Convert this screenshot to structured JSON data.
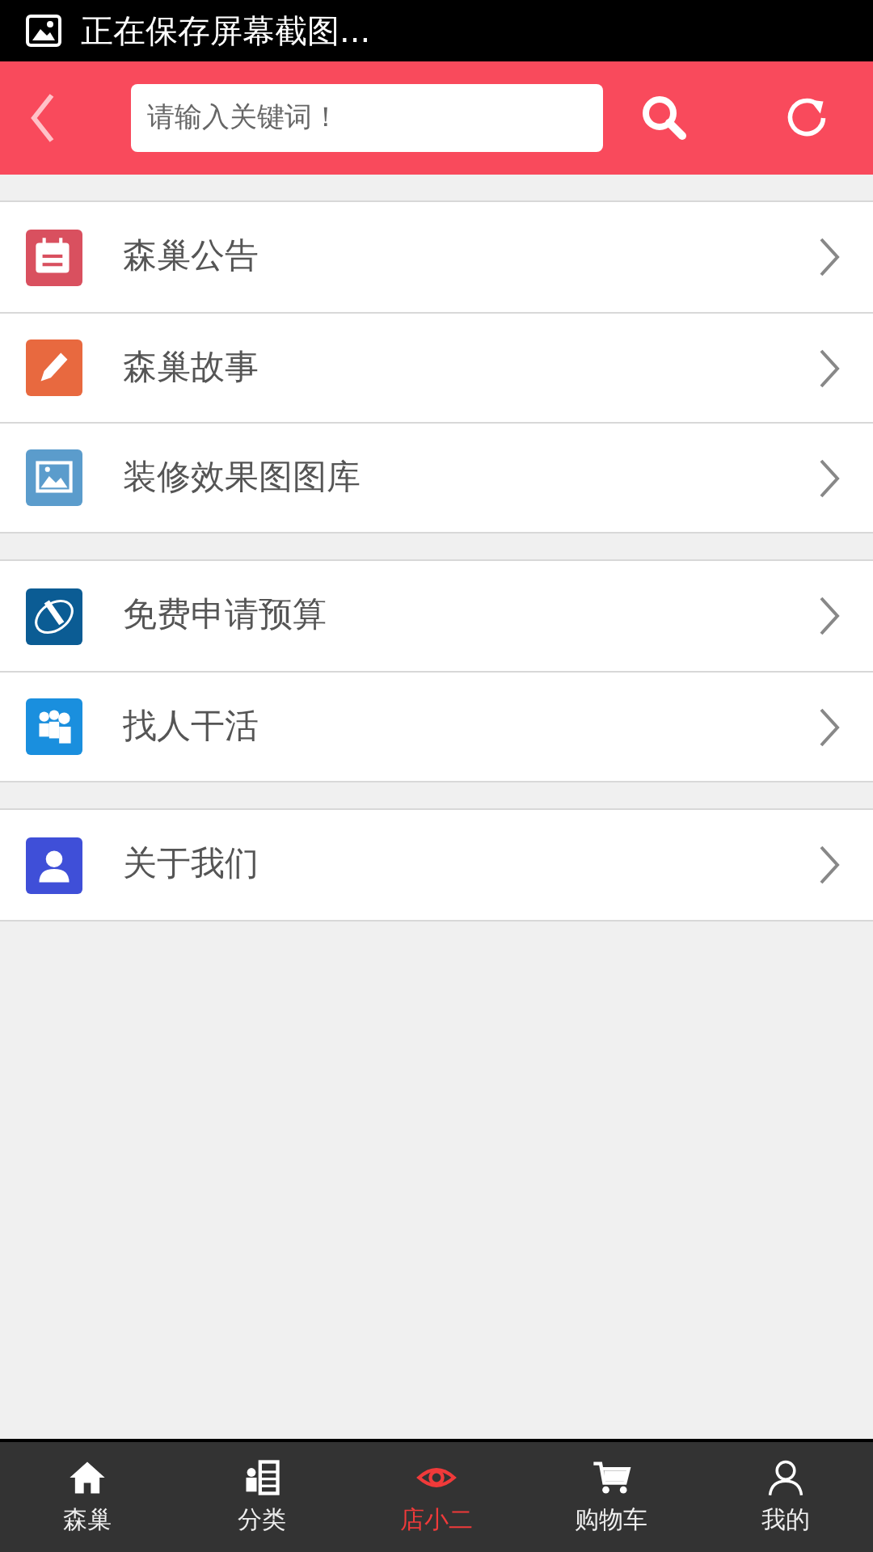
{
  "status_bar": {
    "notification": "正在保存屏幕截图..."
  },
  "header": {
    "search": {
      "placeholder": "请输入关键词！"
    }
  },
  "menu_groups": [
    {
      "items": [
        {
          "label": "森巢公告",
          "color": "#d9505f"
        },
        {
          "label": "森巢故事",
          "color": "#e8693f"
        },
        {
          "label": "装修效果图图库",
          "color": "#5b9ccc"
        }
      ]
    },
    {
      "items": [
        {
          "label": "免费申请预算",
          "color": "#0b5c94"
        },
        {
          "label": "找人干活",
          "color": "#1a8fde"
        }
      ]
    },
    {
      "items": [
        {
          "label": "关于我们",
          "color": "#3f4fd8"
        }
      ]
    }
  ],
  "tab_bar": [
    {
      "label": "森巢",
      "selected": false
    },
    {
      "label": "分类",
      "selected": false
    },
    {
      "label": "店小二",
      "selected": true
    },
    {
      "label": "购物车",
      "selected": false
    },
    {
      "label": "我的",
      "selected": false
    }
  ]
}
